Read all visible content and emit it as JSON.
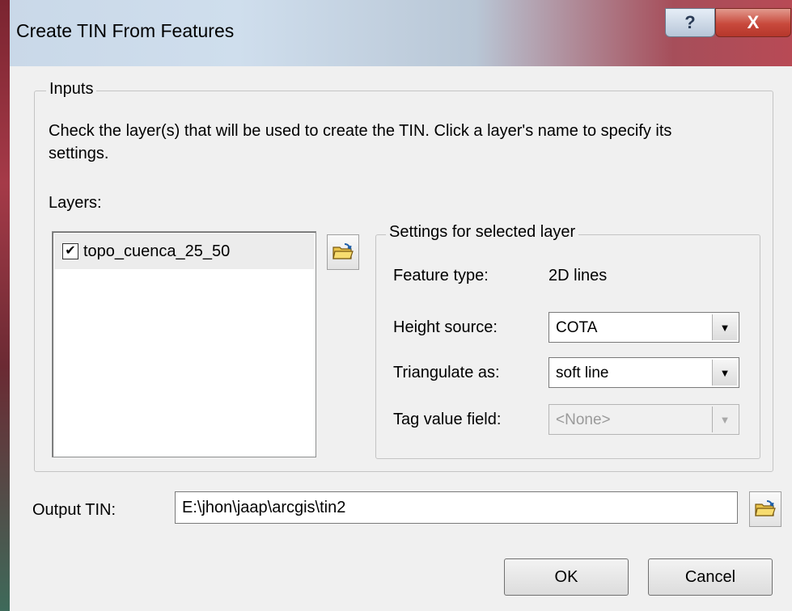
{
  "window": {
    "title": "Create TIN From Features",
    "help_glyph": "?",
    "close_glyph": "X"
  },
  "inputs": {
    "legend": "Inputs",
    "description": "Check the layer(s) that will be used to create the TIN.  Click a layer's name to specify its settings.",
    "layers_label": "Layers:",
    "layers": [
      {
        "name": "topo_cuenca_25_50",
        "checked": true
      }
    ],
    "check_glyph": "✔"
  },
  "settings": {
    "legend": "Settings for selected layer",
    "feature_type_label": "Feature type:",
    "feature_type_value": "2D lines",
    "height_source_label": "Height source:",
    "height_source_value": "COTA",
    "triangulate_label": "Triangulate as:",
    "triangulate_value": "soft line",
    "tag_field_label": "Tag value field:",
    "tag_field_value": "<None>",
    "dropdown_arrow": "▼"
  },
  "output": {
    "label": "Output TIN:",
    "value": "E:\\jhon\\jaap\\arcgis\\tin2"
  },
  "buttons": {
    "ok": "OK",
    "cancel": "Cancel"
  }
}
